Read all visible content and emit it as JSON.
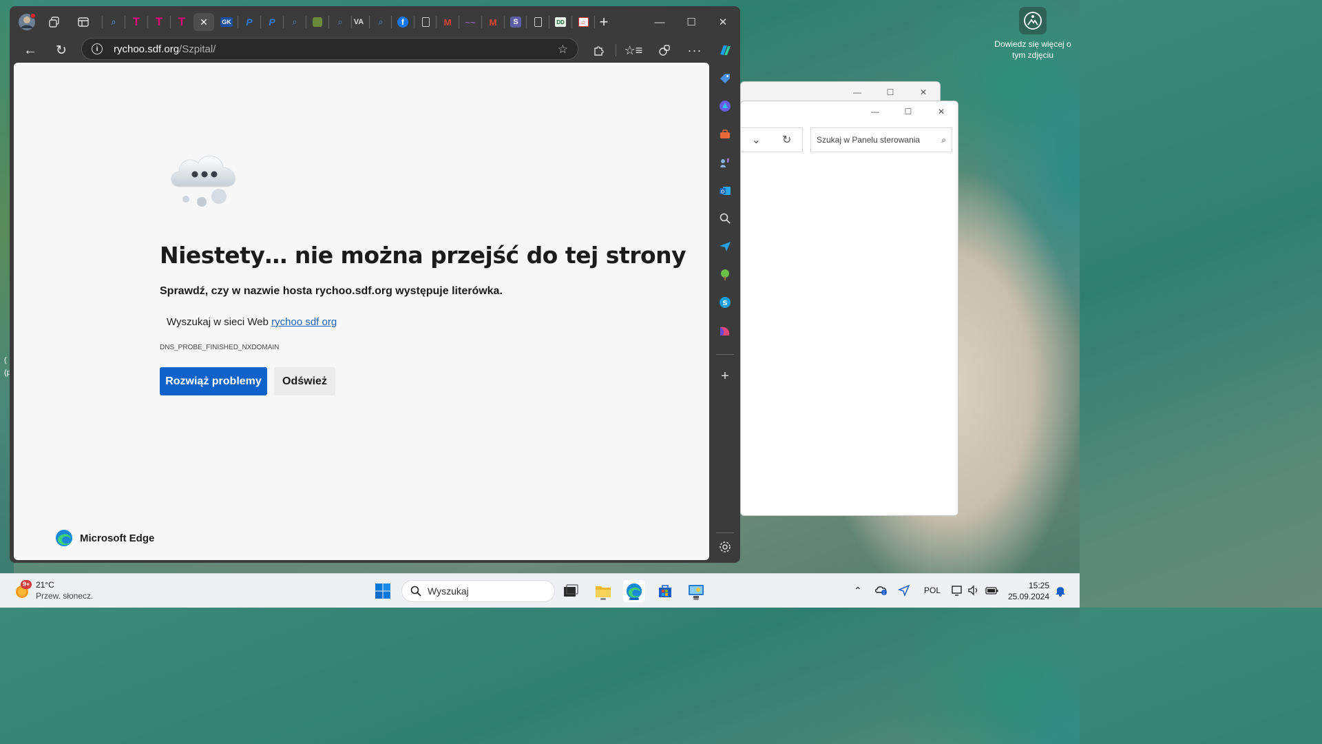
{
  "browser": {
    "url_host": "rychoo.sdf.org",
    "url_path": "/Szpital/",
    "tabs": [
      "search",
      "t-mobile",
      "t-mobile",
      "t-mobile",
      "active-error",
      "gk",
      "paypal",
      "paypal",
      "search",
      "shield",
      "search",
      "va",
      "search",
      "facebook",
      "page",
      "gmail",
      "dash",
      "gmail",
      "s-app",
      "page",
      "dd",
      "pdf"
    ]
  },
  "error_page": {
    "title": "Niestety… nie można przejść do tej strony",
    "hint": "Sprawdź, czy w nazwie hosta rychoo.sdf.org występuje literówka.",
    "search_prefix": "Wyszukaj w sieci Web",
    "search_link": "rychoo sdf org",
    "error_code": "DNS_PROBE_FINISHED_NXDOMAIN",
    "troubleshoot_button": "Rozwiąż problemy",
    "refresh_button": "Odśwież",
    "brand": "Microsoft Edge"
  },
  "control_panel": {
    "search_placeholder": "Szukaj w Panelu sterowania"
  },
  "wallpaper": {
    "info_text": "Dowiedz się więcej o tym zdjęciu"
  },
  "taskbar": {
    "temperature": "21°C",
    "weather_desc": "Przew. słonecz.",
    "weather_badge": "9+",
    "search_text": "Wyszukaj",
    "language": "POL",
    "time": "15:25",
    "date": "25.09.2024"
  },
  "colors": {
    "accent": "#0f62c9",
    "browser_frame": "#3b3b3b",
    "page_bg": "#f7f7f7"
  }
}
